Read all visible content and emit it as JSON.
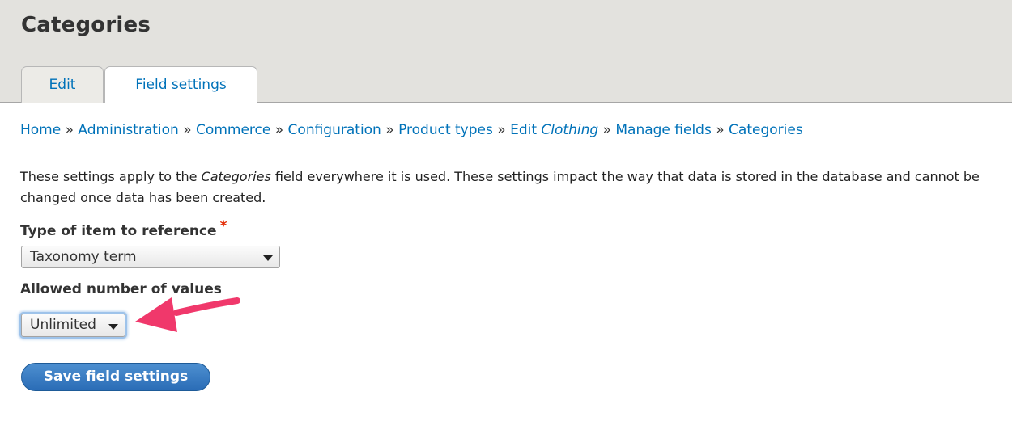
{
  "page_title": "Categories",
  "tabs": [
    {
      "label": "Edit"
    },
    {
      "label": "Field settings"
    }
  ],
  "breadcrumb": {
    "items": [
      "Home",
      "Administration",
      "Commerce",
      "Configuration",
      "Product types"
    ],
    "edit_prefix": "Edit",
    "edit_italic": "Clothing",
    "tail": [
      "Manage fields",
      "Categories"
    ],
    "separator": "»"
  },
  "description": {
    "before": "These settings apply to the",
    "italic": "Categories",
    "after": "field everywhere it is used. These settings impact the way that data is stored in the database and cannot be changed once data has been created."
  },
  "type_field": {
    "label": "Type of item to reference",
    "required_marker": "*",
    "value": "Taxonomy term"
  },
  "allowed_field": {
    "label": "Allowed number of values",
    "value": "Unlimited"
  },
  "save_button": "Save field settings",
  "colors": {
    "link": "#0072b9",
    "header_bg": "#e3e2de",
    "required": "#e32700",
    "annotation_arrow": "#f0386b",
    "button": "#2a6cb6"
  }
}
